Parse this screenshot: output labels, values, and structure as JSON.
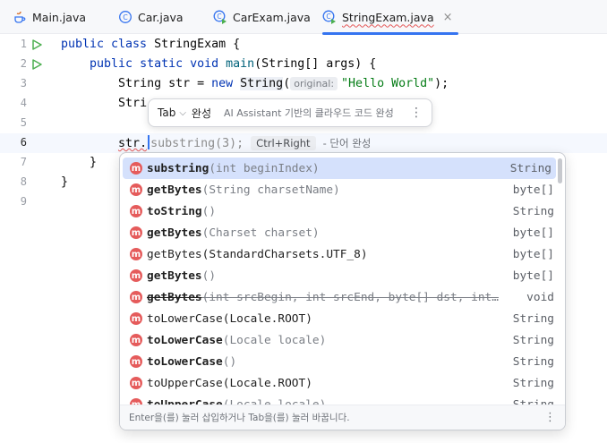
{
  "tabs": [
    {
      "label": "Main.java",
      "icon": "java-file-icon",
      "active": false
    },
    {
      "label": "Car.java",
      "icon": "class-c-icon",
      "active": false
    },
    {
      "label": "CarExam.java",
      "icon": "class-run-icon",
      "active": false
    },
    {
      "label": "StringExam.java",
      "icon": "class-run-icon",
      "active": true,
      "close": "×"
    }
  ],
  "gutter": {
    "line_numbers": [
      "1",
      "2",
      "3",
      "4",
      "5",
      "6",
      "7",
      "8",
      "9"
    ]
  },
  "code": {
    "line1": {
      "kw": "public class ",
      "name": "StringExam {"
    },
    "line2": {
      "kw1": "public static void ",
      "fn": "main",
      "rest": "(String[] args) {"
    },
    "line3": {
      "type": "String str = ",
      "kw": "new ",
      "cls": "String",
      "paren": "(",
      "hint": "original:",
      "str": "\"Hello World\"",
      "end": ");"
    },
    "line4": {
      "partial": "Stri"
    },
    "line6": {
      "before": "str.",
      "ghost": "substring(",
      "ghost_num": "3",
      "ghost_end": ");",
      "kbd": "Ctrl+Right",
      "hint": "- 단어 완성"
    },
    "line7": "}",
    "line8": "}"
  },
  "tab_tooltip": {
    "key": "Tab",
    "action": "완성",
    "description": "AI Assistant 기반의 클라우드 코드 완성"
  },
  "completion": {
    "items": [
      {
        "name": "substring",
        "params": "(int beginIndex)",
        "type": "String",
        "bold": true,
        "selected": true,
        "strike": false
      },
      {
        "name": "getBytes",
        "params": "(String charsetName)",
        "type": "byte[]",
        "bold": true,
        "selected": false,
        "strike": false
      },
      {
        "name": "toString",
        "params": "()",
        "type": "String",
        "bold": true,
        "selected": false,
        "strike": false
      },
      {
        "name": "getBytes",
        "params": "(Charset charset)",
        "type": "byte[]",
        "bold": true,
        "selected": false,
        "strike": false
      },
      {
        "name": "getBytes(StandardCharsets.UTF_8)",
        "params": "",
        "type": "byte[]",
        "bold": false,
        "selected": false,
        "strike": false
      },
      {
        "name": "getBytes",
        "params": "()",
        "type": "byte[]",
        "bold": true,
        "selected": false,
        "strike": false
      },
      {
        "name": "getBytes",
        "params": "(int srcBegin, int srcEnd, byte[] dst, int…",
        "type": "void",
        "bold": true,
        "selected": false,
        "strike": true
      },
      {
        "name": "toLowerCase(Locale.ROOT)",
        "params": "",
        "type": "String",
        "bold": false,
        "selected": false,
        "strike": false
      },
      {
        "name": "toLowerCase",
        "params": "(Locale locale)",
        "type": "String",
        "bold": true,
        "selected": false,
        "strike": false
      },
      {
        "name": "toLowerCase",
        "params": "()",
        "type": "String",
        "bold": true,
        "selected": false,
        "strike": false
      },
      {
        "name": "toUpperCase(Locale.ROOT)",
        "params": "",
        "type": "String",
        "bold": false,
        "selected": false,
        "strike": false
      },
      {
        "name": "toUpperCase",
        "params": "(Locale locale)",
        "type": "String",
        "bold": true,
        "selected": false,
        "strike": false
      }
    ],
    "icon_letter": "m",
    "footer": "Enter을(를) 눌러 삽입하거나 Tab을(를) 눌러 바꿉니다."
  },
  "colors": {
    "accent": "#3574f0",
    "method_icon": "#e55b5b",
    "keyword": "#0033b3",
    "string": "#067d17",
    "selected_row": "#d5e1fc"
  }
}
